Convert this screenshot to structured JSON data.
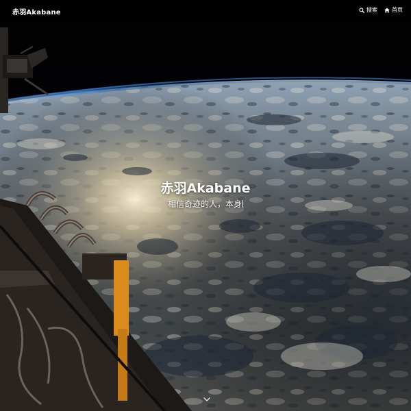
{
  "site": {
    "title": "赤羽Akabane"
  },
  "nav": {
    "items": [
      {
        "label": "搜索",
        "icon": "search-icon"
      },
      {
        "label": "首页",
        "icon": "home-icon"
      }
    ]
  },
  "hero": {
    "title": "赤羽Akabane",
    "subtitle": "相信奇迹的人，本身"
  },
  "colors": {
    "space": "#020305",
    "atmosphere": "#4a86c8",
    "cloud": "#c9c7bf",
    "ocean": "#1c2838",
    "sunglare": "#f3e6c2",
    "truss_orange": "#d98b1c",
    "structure_dark": "#1d1917"
  },
  "scroll_indicator": {
    "icon": "chevron-down-icon"
  }
}
